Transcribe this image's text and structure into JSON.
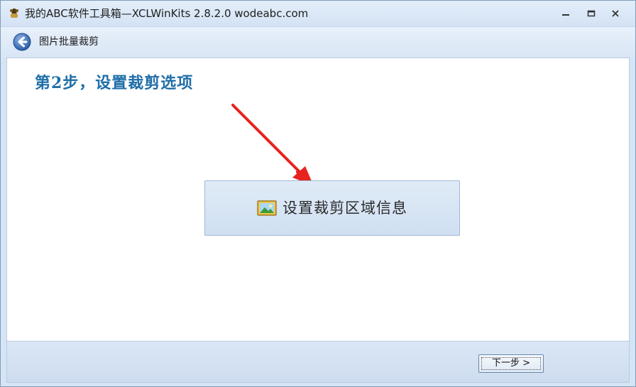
{
  "window": {
    "title": "我的ABC软件工具箱—XCLWinKits 2.8.2.0  wodeabc.com",
    "icons": [
      "app-icon",
      "minimize-icon",
      "maximize-icon",
      "close-icon"
    ]
  },
  "nav": {
    "title": "图片批量裁剪",
    "back_icon": "back-arrow-icon"
  },
  "main": {
    "step_title": "第2步，设置裁剪选项",
    "crop_button_label": "设置裁剪区域信息",
    "crop_button_icon": "image-icon",
    "annotation": "red-arrow"
  },
  "footer": {
    "next_label": "下一步 >"
  },
  "colors": {
    "step_title": "#1f6ea8",
    "arrow": "#e8231f",
    "frame": "#d6e5f5"
  }
}
